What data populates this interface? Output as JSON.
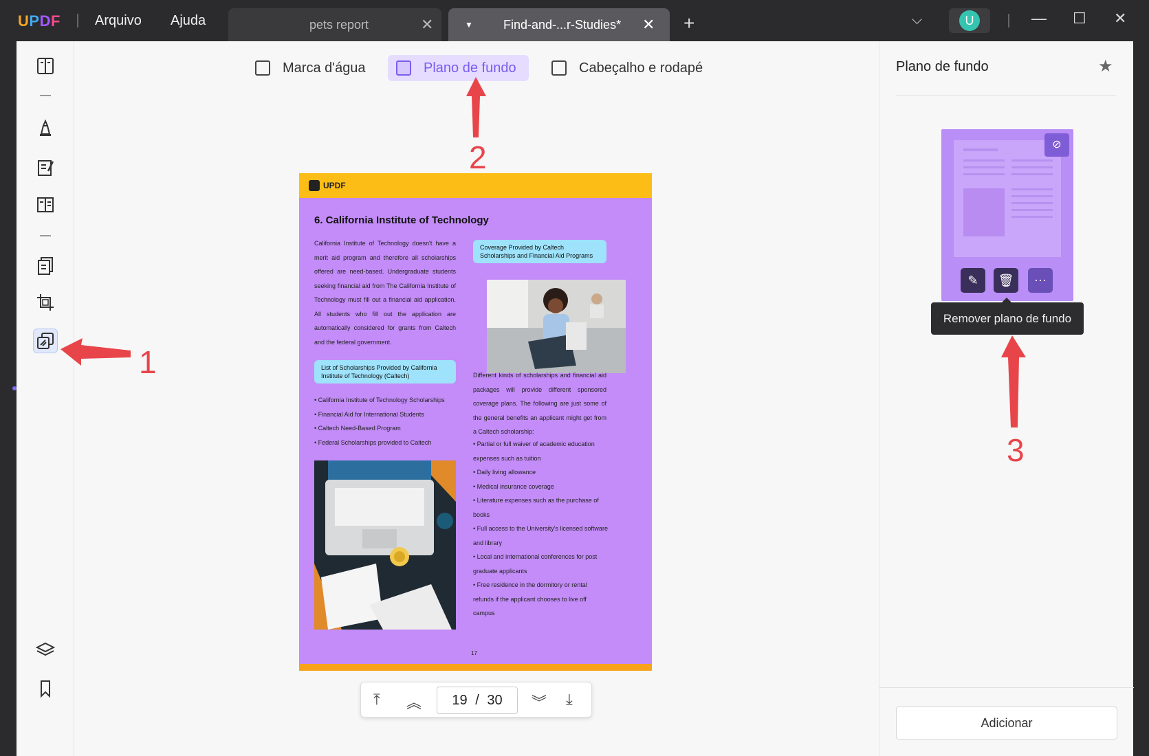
{
  "app": {
    "logo": {
      "u": "U",
      "p": "P",
      "d": "D",
      "f": "F"
    },
    "menu": [
      "Arquivo",
      "Ajuda"
    ],
    "tabs": [
      {
        "label": "pets report"
      },
      {
        "label": "Find-and-...r-Studies*"
      }
    ],
    "avatar_letter": "U"
  },
  "toolbar": {
    "items": [
      {
        "label": "Marca d'água"
      },
      {
        "label": "Plano de fundo"
      },
      {
        "label": "Cabeçalho e rodapé"
      }
    ]
  },
  "document": {
    "header_logo": "UPDF",
    "title": "6. California Institute of Technology",
    "left_paragraph": "California Institute of Technology doesn't have a merit aid program and therefore all scholarships offered are need-based. Undergraduate students seeking financial aid from The California Institute of Technology must fill out a financial aid application. All students who fill out the application are automatically considered for grants from Caltech and the federal government.",
    "left_callout": "List of Scholarships Provided by California Institute of Technology (Caltech)",
    "left_bullets": [
      "• California Institute of Technology Scholarships",
      "• Financial Aid for International Students",
      "• Caltech Need-Based Program",
      "• Federal Scholarships provided to Caltech"
    ],
    "right_callout": "Coverage Provided by Caltech Scholarships and Financial Aid Programs",
    "right_paragraph": "Different kinds of scholarships and financial aid packages will provide different sponsored coverage plans. The following are just some of the general benefits an applicant might get from a Caltech scholarship:",
    "right_bullets": [
      "• Partial or full waiver of academic education expenses such as tuition",
      "• Daily living allowance",
      "• Medical insurance coverage",
      "• Literature expenses such as the purchase of books",
      "• Full access to the University's licensed software and library",
      "• Local and international conferences for post graduate applicants",
      "• Free residence in the dormitory or rental refunds if the applicant chooses to live off campus"
    ],
    "page_number": "17"
  },
  "pagenav": {
    "current": "19",
    "separator": "/",
    "total": "30"
  },
  "right_panel": {
    "title": "Plano de fundo",
    "tooltip": "Remover plano de fundo",
    "add_button": "Adicionar"
  },
  "annotations": [
    "1",
    "2",
    "3"
  ],
  "colors": {
    "accent": "#7b5cf0",
    "background_purple": "#c38cf8",
    "arrow_red": "#e8454a"
  }
}
